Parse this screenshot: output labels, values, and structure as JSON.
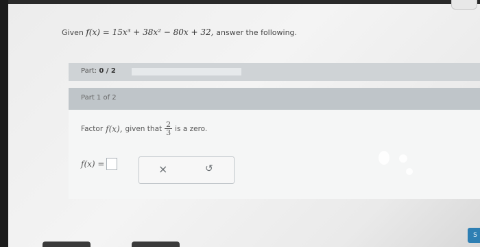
{
  "problem": {
    "prefix": "Given",
    "function": "f(x) = 15x³ + 38x² − 80x + 32,",
    "suffix": "answer the following."
  },
  "part": {
    "label": "Part:",
    "progress": "0 / 2",
    "progress_fraction": 0
  },
  "subpart": {
    "label": "Part 1 of 2"
  },
  "question": {
    "text_before": "Factor",
    "function": "f(x),",
    "text_mid": "given that",
    "zero_numerator": "2",
    "zero_denominator": "3",
    "text_after": "is a zero."
  },
  "answer": {
    "prefix": "f(x) =",
    "value": ""
  },
  "tools": {
    "clear_icon": "×",
    "undo_icon": "↺"
  },
  "corner_button": {
    "label": "S"
  }
}
